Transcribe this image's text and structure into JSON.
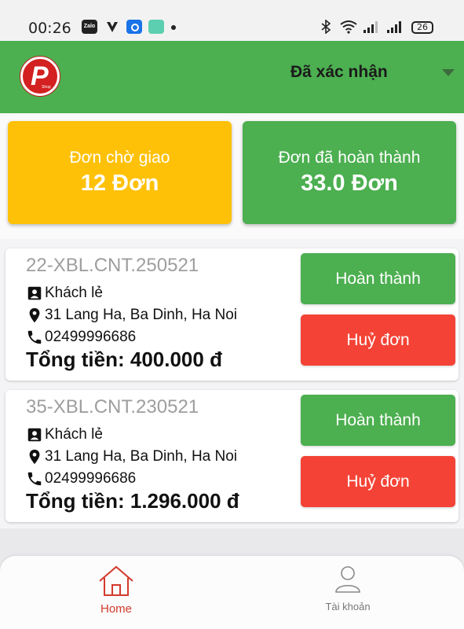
{
  "status_bar": {
    "time": "00:26",
    "battery": "26",
    "zalo_label": "Zalo"
  },
  "header": {
    "logo_letter": "P",
    "logo_sub": "Shop",
    "status_filter": "Đã xác nhận"
  },
  "summary": {
    "pending": {
      "label": "Đơn chờ giao",
      "value": "12 Đơn"
    },
    "completed": {
      "label": "Đơn đã hoàn thành",
      "value": "33.0 Đơn"
    }
  },
  "orders": [
    {
      "code": "22-XBL.CNT.250521",
      "customer": "Khách lẻ",
      "address": "31 Lang Ha, Ba Dinh, Ha Noi",
      "phone": "02499996686",
      "total": "Tổng tiền: 400.000 đ",
      "complete_label": "Hoàn thành",
      "cancel_label": "Huỷ đơn"
    },
    {
      "code": "35-XBL.CNT.230521",
      "customer": "Khách lẻ",
      "address": "31 Lang Ha, Ba Dinh, Ha Noi",
      "phone": "02499996686",
      "total": "Tổng tiền: 1.296.000 đ",
      "complete_label": "Hoàn thành",
      "cancel_label": "Huỷ đơn"
    }
  ],
  "nav": {
    "home": "Home",
    "account": "Tài khoản"
  },
  "colors": {
    "primary": "#4caf50",
    "warning": "#ffc107",
    "danger": "#f44336",
    "nav_active": "#d33a2c"
  }
}
